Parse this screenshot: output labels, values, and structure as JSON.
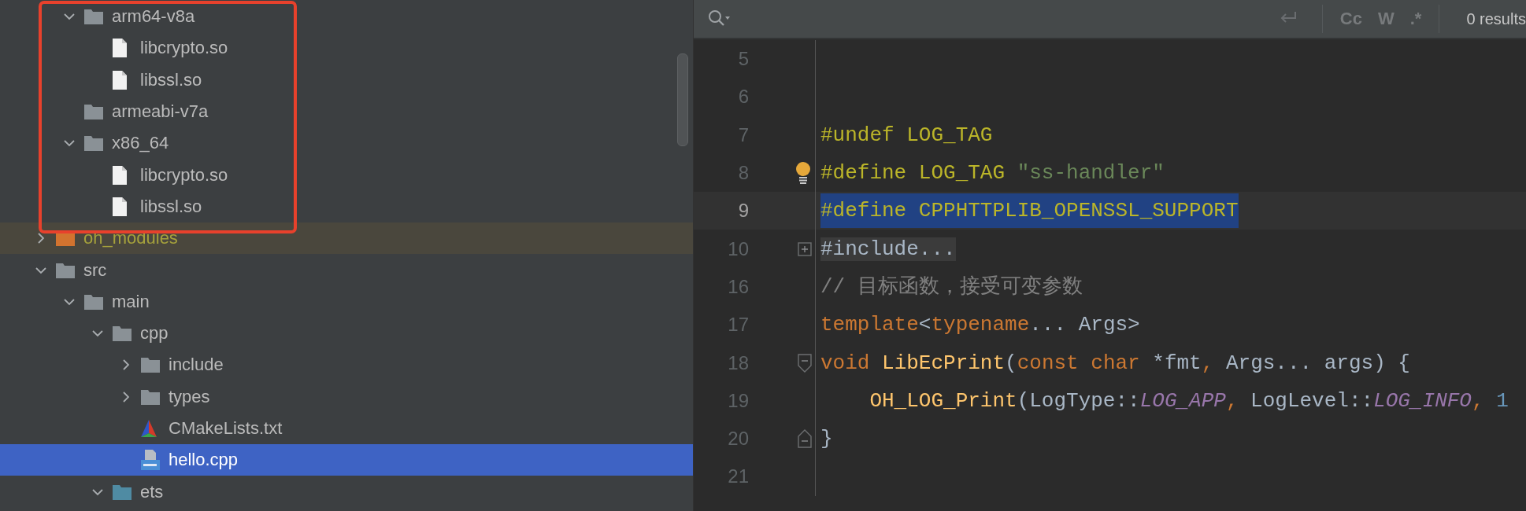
{
  "tree": {
    "partial_group": {
      "annotated": true,
      "rows": [
        {
          "label": "arm64-v8a",
          "kind": "folder",
          "expanded": true,
          "selected": false,
          "children": [
            {
              "label": "libcrypto.so",
              "kind": "file",
              "selected": false
            },
            {
              "label": "libssl.so",
              "kind": "file",
              "selected": false
            }
          ]
        },
        {
          "label": "armeabi-v7a",
          "kind": "folder",
          "selected": false
        },
        {
          "label": "x86_64",
          "kind": "folder",
          "expanded": true,
          "selected": false,
          "children": [
            {
              "label": "libcrypto.so",
              "kind": "file",
              "selected": false
            },
            {
              "label": "libssl.so",
              "kind": "file",
              "selected": false
            }
          ]
        }
      ]
    },
    "items": [
      {
        "label": "oh_modules",
        "kind": "excluded_folder",
        "expanded": false,
        "highlighted": true,
        "selected": false
      },
      {
        "label": "src",
        "kind": "folder",
        "expanded": true,
        "selected": false,
        "children": [
          {
            "label": "main",
            "kind": "folder",
            "expanded": true,
            "selected": false,
            "children": [
              {
                "label": "cpp",
                "kind": "folder",
                "expanded": true,
                "selected": false,
                "children": [
                  {
                    "label": "include",
                    "kind": "folder",
                    "expanded": false,
                    "selected": false
                  },
                  {
                    "label": "types",
                    "kind": "folder",
                    "expanded": false,
                    "selected": false
                  },
                  {
                    "label": "CMakeLists.txt",
                    "kind": "cmake",
                    "selected": false
                  },
                  {
                    "label": "hello.cpp",
                    "kind": "cpp",
                    "selected": true
                  }
                ]
              },
              {
                "label": "ets",
                "kind": "source_folder",
                "expanded": true,
                "selected": false
              }
            ]
          }
        ]
      }
    ]
  },
  "search": {
    "options": [
      {
        "label": "Cc",
        "selected": false
      },
      {
        "label": "W",
        "selected": false
      },
      {
        "label": ".*",
        "selected": false
      }
    ],
    "results": "0 results"
  },
  "code": {
    "lines": [
      {
        "number": "5",
        "current": false
      },
      {
        "number": "6",
        "current": false
      },
      {
        "number": "7",
        "current": false,
        "tokens": [
          {
            "text": "#undef LOG_TAG",
            "kind": "preproc"
          }
        ]
      },
      {
        "number": "8",
        "current": false,
        "bulb": true,
        "tokens": [
          {
            "text": "#define LOG_TAG ",
            "kind": "preproc"
          },
          {
            "text": "\"ss-handler\"",
            "kind": "string"
          }
        ]
      },
      {
        "number": "9",
        "current": true,
        "selected": true,
        "tokens": [
          {
            "text": "#define CPPHTTPLIB_OPENSSL_SUPPORT",
            "kind": "preproc"
          }
        ]
      },
      {
        "number": "10",
        "current": false,
        "collapsed": true,
        "tokens": [
          {
            "text": "#include...",
            "kind": "folded"
          }
        ]
      },
      {
        "number": "16",
        "current": false,
        "tokens": [
          {
            "text": "// 目标函数，接受可变参数",
            "kind": "comment"
          }
        ]
      },
      {
        "number": "17",
        "current": false,
        "tokens": [
          {
            "text": "template",
            "kind": "keyword"
          },
          {
            "text": "<",
            "kind": "plain"
          },
          {
            "text": "typename",
            "kind": "keyword"
          },
          {
            "text": "... Args>",
            "kind": "plain"
          }
        ]
      },
      {
        "number": "18",
        "current": false,
        "fold_start": true,
        "tokens": [
          {
            "text": "void",
            "kind": "keyword"
          },
          {
            "text": " LibEcPrint",
            "kind": "function"
          },
          {
            "text": "(",
            "kind": "plain"
          },
          {
            "text": "const",
            "kind": "keyword"
          },
          {
            "text": " char",
            "kind": "keyword"
          },
          {
            "text": " *fmt",
            "kind": "plain"
          },
          {
            "text": ", ",
            "kind": "keyword"
          },
          {
            "text": "Args... args) {",
            "kind": "plain"
          }
        ]
      },
      {
        "number": "19",
        "current": false,
        "tokens": [
          {
            "text": "    OH_LOG_Print",
            "kind": "function"
          },
          {
            "text": "(LogType::",
            "kind": "plain"
          },
          {
            "text": "LOG_APP",
            "kind": "constant"
          },
          {
            "text": ", ",
            "kind": "keyword"
          },
          {
            "text": "LogLevel::",
            "kind": "plain"
          },
          {
            "text": "LOG_INFO",
            "kind": "constant"
          },
          {
            "text": ", ",
            "kind": "keyword"
          },
          {
            "text": "1",
            "kind": "number"
          }
        ]
      },
      {
        "number": "20",
        "current": false,
        "fold_end": true,
        "tokens": [
          {
            "text": "}",
            "kind": "plain"
          }
        ]
      },
      {
        "number": "21",
        "current": false
      }
    ]
  }
}
